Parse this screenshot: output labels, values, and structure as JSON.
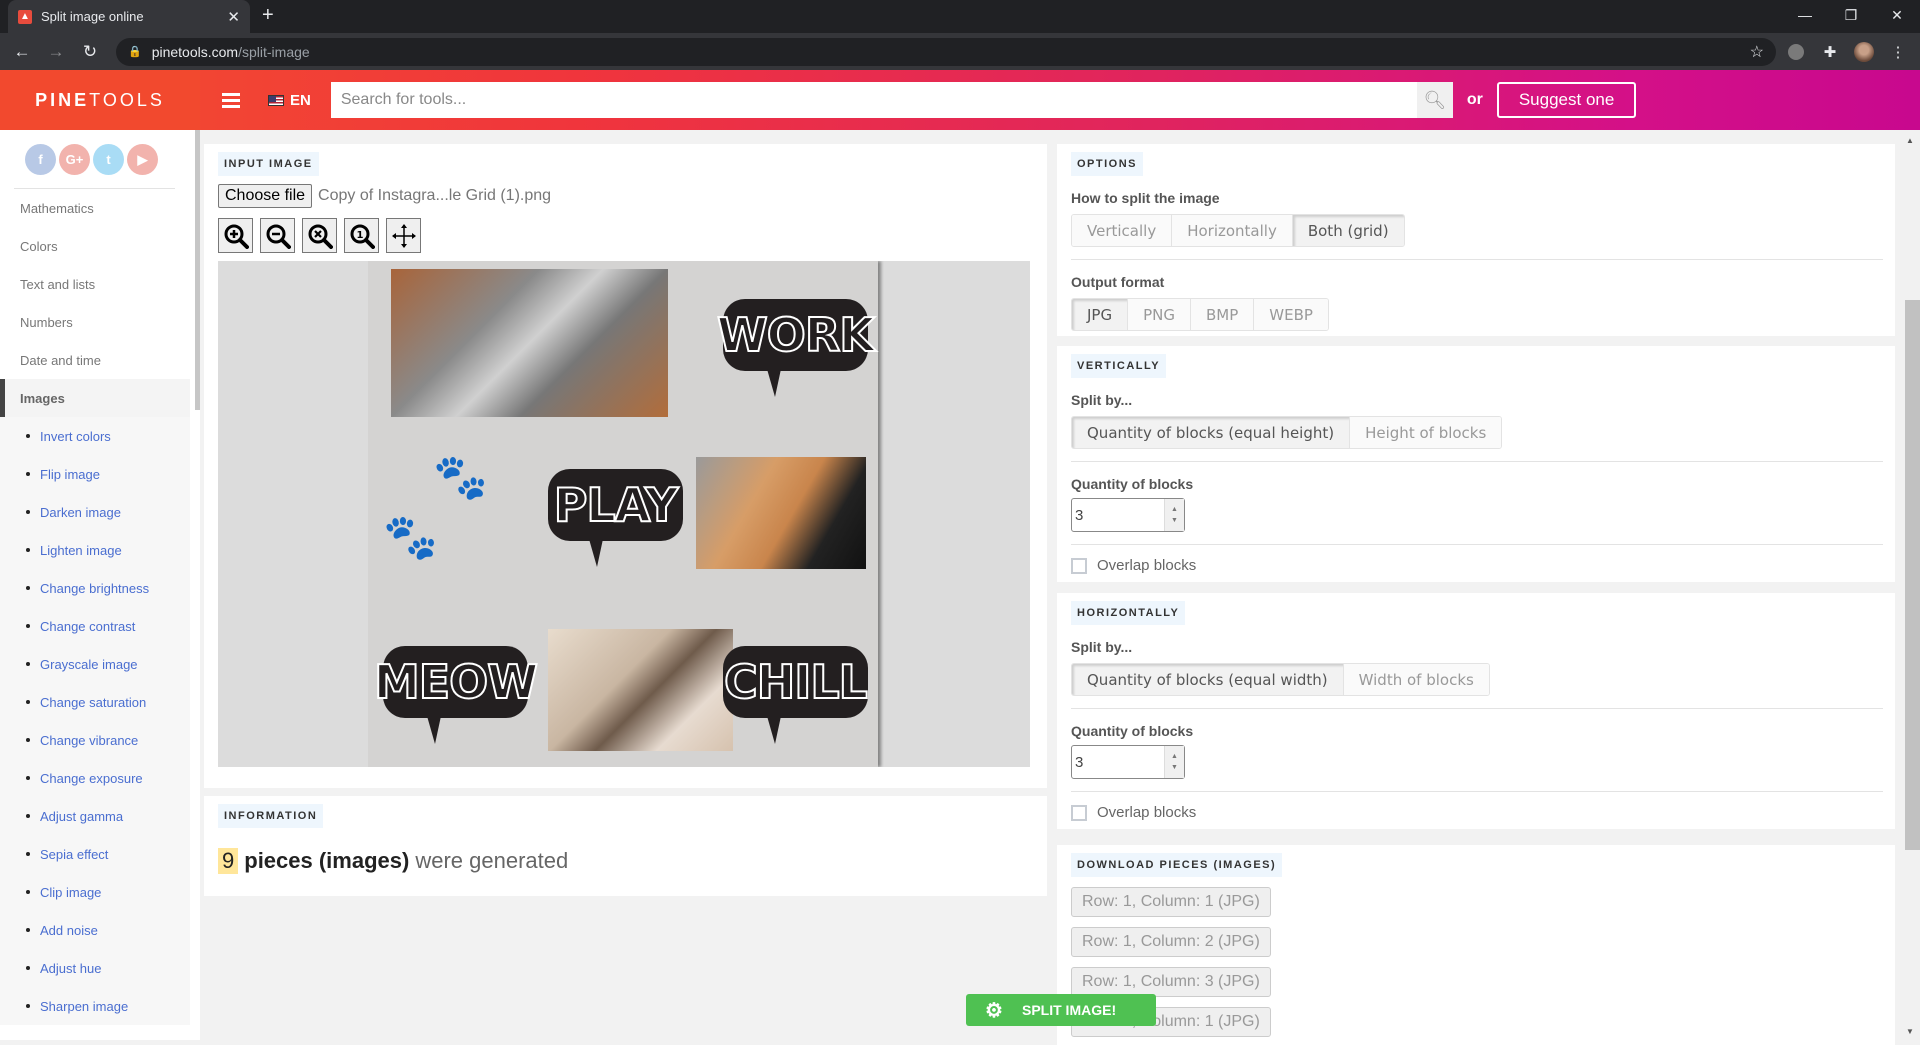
{
  "browser": {
    "tab_title": "Split image online",
    "url_domain": "pinetools.com",
    "url_path": "/split-image"
  },
  "header": {
    "logo_bold": "PINE",
    "logo_light": "TOOLS",
    "language": "EN",
    "search_placeholder": "Search for tools...",
    "or_label": "or",
    "suggest_label": "Suggest one"
  },
  "sidebar": {
    "social": [
      {
        "icon": "facebook-icon",
        "glyph": "f",
        "color": "#b8c9e6"
      },
      {
        "icon": "google-plus-icon",
        "glyph": "G+",
        "color": "#f2b3ad"
      },
      {
        "icon": "twitter-icon",
        "glyph": "t",
        "color": "#a9dcf5"
      },
      {
        "icon": "youtube-icon",
        "glyph": "▶",
        "color": "#f2b3ad"
      }
    ],
    "categories": [
      "Mathematics",
      "Colors",
      "Text and lists",
      "Numbers",
      "Date and time",
      "Images"
    ],
    "active_category": "Images",
    "sub_items": [
      "Invert colors",
      "Flip image",
      "Darken image",
      "Lighten image",
      "Change brightness",
      "Change contrast",
      "Grayscale image",
      "Change saturation",
      "Change vibrance",
      "Change exposure",
      "Adjust gamma",
      "Sepia effect",
      "Clip image",
      "Add noise",
      "Adjust hue",
      "Sharpen image"
    ]
  },
  "input": {
    "title": "INPUT IMAGE",
    "choose_file_label": "Choose file",
    "file_name": "Copy of Instagra...le Grid (1).png",
    "zoom_tools": [
      "zoom-in-icon",
      "zoom-out-icon",
      "zoom-reset-icon",
      "zoom-actual-size-icon",
      "move-icon"
    ],
    "poster_words": [
      "WORK",
      "PLAY",
      "MEOW",
      "CHILL"
    ]
  },
  "information": {
    "title": "INFORMATION",
    "count": "9",
    "bold_text": "pieces (images)",
    "tail_text": "were generated"
  },
  "options": {
    "title": "OPTIONS",
    "split_label": "How to split the image",
    "split_options": [
      "Vertically",
      "Horizontally",
      "Both (grid)"
    ],
    "split_selected": "Both (grid)",
    "format_label": "Output format",
    "formats": [
      "JPG",
      "PNG",
      "BMP",
      "WEBP"
    ],
    "format_selected": "JPG"
  },
  "vertically": {
    "title": "VERTICALLY",
    "split_by_label": "Split by...",
    "split_by_options": [
      "Quantity of blocks (equal height)",
      "Height of blocks"
    ],
    "split_by_selected": "Quantity of blocks (equal height)",
    "quantity_label": "Quantity of blocks",
    "quantity_value": "3",
    "overlap_label": "Overlap blocks",
    "overlap_checked": false
  },
  "horizontally": {
    "title": "HORIZONTALLY",
    "split_by_label": "Split by...",
    "split_by_options": [
      "Quantity of blocks (equal width)",
      "Width of blocks"
    ],
    "split_by_selected": "Quantity of blocks (equal width)",
    "quantity_label": "Quantity of blocks",
    "quantity_value": "3",
    "overlap_label": "Overlap blocks",
    "overlap_checked": false
  },
  "download": {
    "title": "DOWNLOAD PIECES (IMAGES)",
    "pieces": [
      "Row: 1, Column: 1 (JPG)",
      "Row: 1, Column: 2 (JPG)",
      "Row: 1, Column: 3 (JPG)",
      "Row: 2, Column: 1 (JPG)"
    ]
  },
  "split_button_label": "SPLIT IMAGE!",
  "colors": {
    "accent_green": "#4fc152",
    "link_blue": "#4a6ed0",
    "header_red": "#f2492e",
    "header_magenta": "#c8088e"
  }
}
